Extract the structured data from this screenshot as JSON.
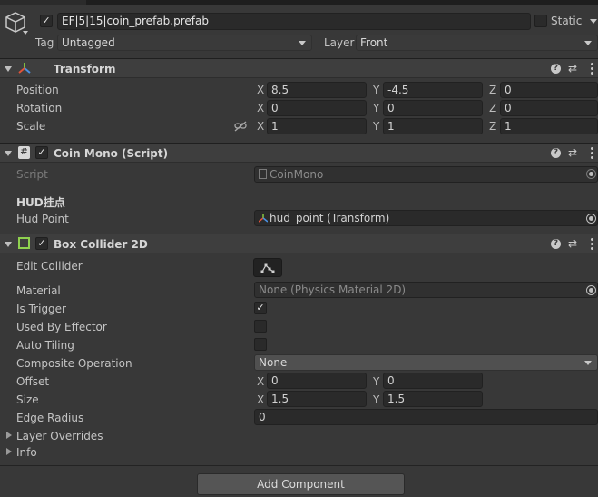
{
  "gameobject": {
    "name": "EF|5|15|coin_prefab.prefab",
    "static_label": "Static",
    "tag_label": "Tag",
    "tag_value": "Untagged",
    "layer_label": "Layer",
    "layer_value": "Front"
  },
  "transform": {
    "title": "Transform",
    "position_label": "Position",
    "rotation_label": "Rotation",
    "scale_label": "Scale",
    "axis_x": "X",
    "axis_y": "Y",
    "axis_z": "Z",
    "position": {
      "x": "8.5",
      "y": "-4.5",
      "z": "0"
    },
    "rotation": {
      "x": "0",
      "y": "0",
      "z": "0"
    },
    "scale": {
      "x": "1",
      "y": "1",
      "z": "1"
    }
  },
  "coin_mono": {
    "title": "Coin Mono (Script)",
    "script_label": "Script",
    "script_value": "CoinMono",
    "section_header": "HUD挂点",
    "hud_point_label": "Hud Point",
    "hud_point_value": "hud_point (Transform)"
  },
  "box_collider": {
    "title": "Box Collider 2D",
    "edit_collider_label": "Edit Collider",
    "material_label": "Material",
    "material_value": "None (Physics Material 2D)",
    "is_trigger_label": "Is Trigger",
    "is_trigger": true,
    "used_by_effector_label": "Used By Effector",
    "used_by_effector": false,
    "auto_tiling_label": "Auto Tiling",
    "auto_tiling": false,
    "composite_label": "Composite Operation",
    "composite_value": "None",
    "offset_label": "Offset",
    "offset": {
      "x": "0",
      "y": "0"
    },
    "size_label": "Size",
    "size": {
      "x": "1.5",
      "y": "1.5"
    },
    "edge_radius_label": "Edge Radius",
    "edge_radius_value": "0",
    "layer_overrides_label": "Layer Overrides",
    "info_label": "Info"
  },
  "footer": {
    "add_component_label": "Add Component"
  },
  "check_glyph": "✓"
}
